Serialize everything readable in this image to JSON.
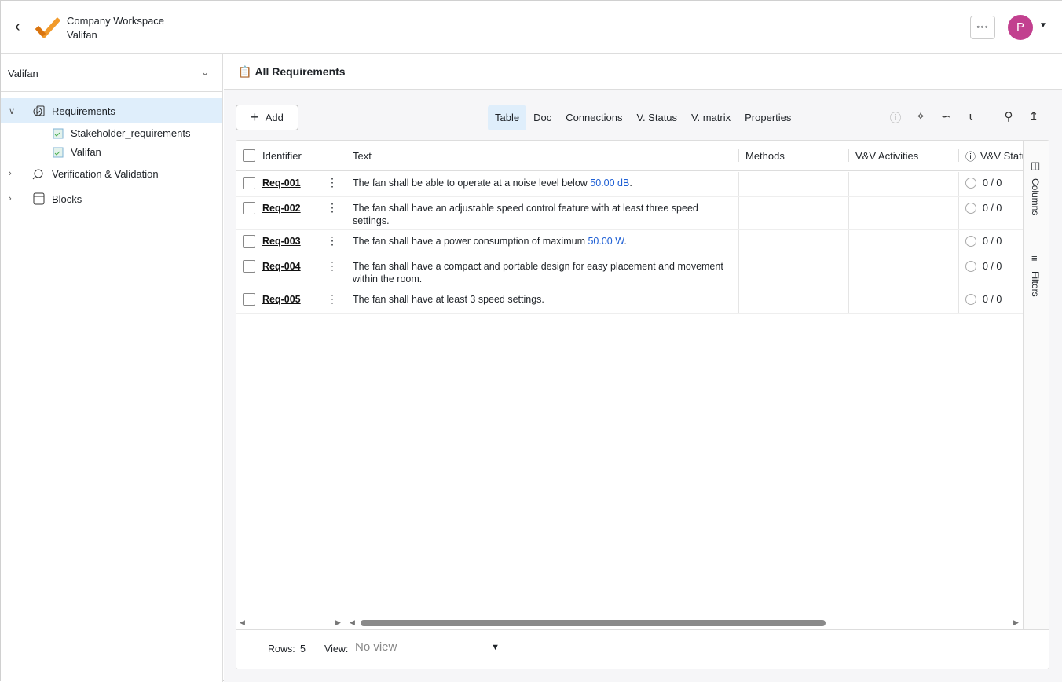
{
  "header": {
    "workspace": "Company Workspace",
    "project": "Valifan",
    "avatar_initial": "P"
  },
  "sidebar": {
    "project_select": "Valifan",
    "items": [
      {
        "label": "Requirements",
        "children": [
          "Stakeholder_requirements",
          "Valifan"
        ]
      },
      {
        "label": "Verification & Validation"
      },
      {
        "label": "Blocks"
      }
    ]
  },
  "main": {
    "title": "All Requirements",
    "add_label": "Add",
    "tabs": [
      "Table",
      "Doc",
      "Connections",
      "V. Status",
      "V. matrix",
      "Properties"
    ],
    "columns": [
      "Identifier",
      "Text",
      "Methods",
      "V&V Activities",
      "V&V Status"
    ],
    "rows": [
      {
        "id": "Req-001",
        "text": "The fan shall be able to operate at a noise level below ",
        "value": "50.00  dB",
        "tail": ".",
        "status": "0 / 0"
      },
      {
        "id": "Req-002",
        "text": "The fan shall have an adjustable speed control feature with at least three speed settings.",
        "value": "",
        "tail": "",
        "status": "0 / 0"
      },
      {
        "id": "Req-003",
        "text": "The fan shall have a power consumption of maximum ",
        "value": "50.00  W",
        "tail": ".",
        "status": "0 / 0"
      },
      {
        "id": "Req-004",
        "text": "The fan shall have a compact and portable design for easy placement and movement within the room.",
        "value": "",
        "tail": "",
        "status": "0 / 0"
      },
      {
        "id": "Req-005",
        "text": "The fan shall have at least 3 speed settings.",
        "value": "",
        "tail": "",
        "status": "0 / 0"
      }
    ],
    "side_panel": [
      "Columns",
      "Filters"
    ],
    "footer": {
      "rows_label": "Rows:",
      "rows_count": "5",
      "view_label": "View:",
      "view_value": "No view"
    }
  }
}
